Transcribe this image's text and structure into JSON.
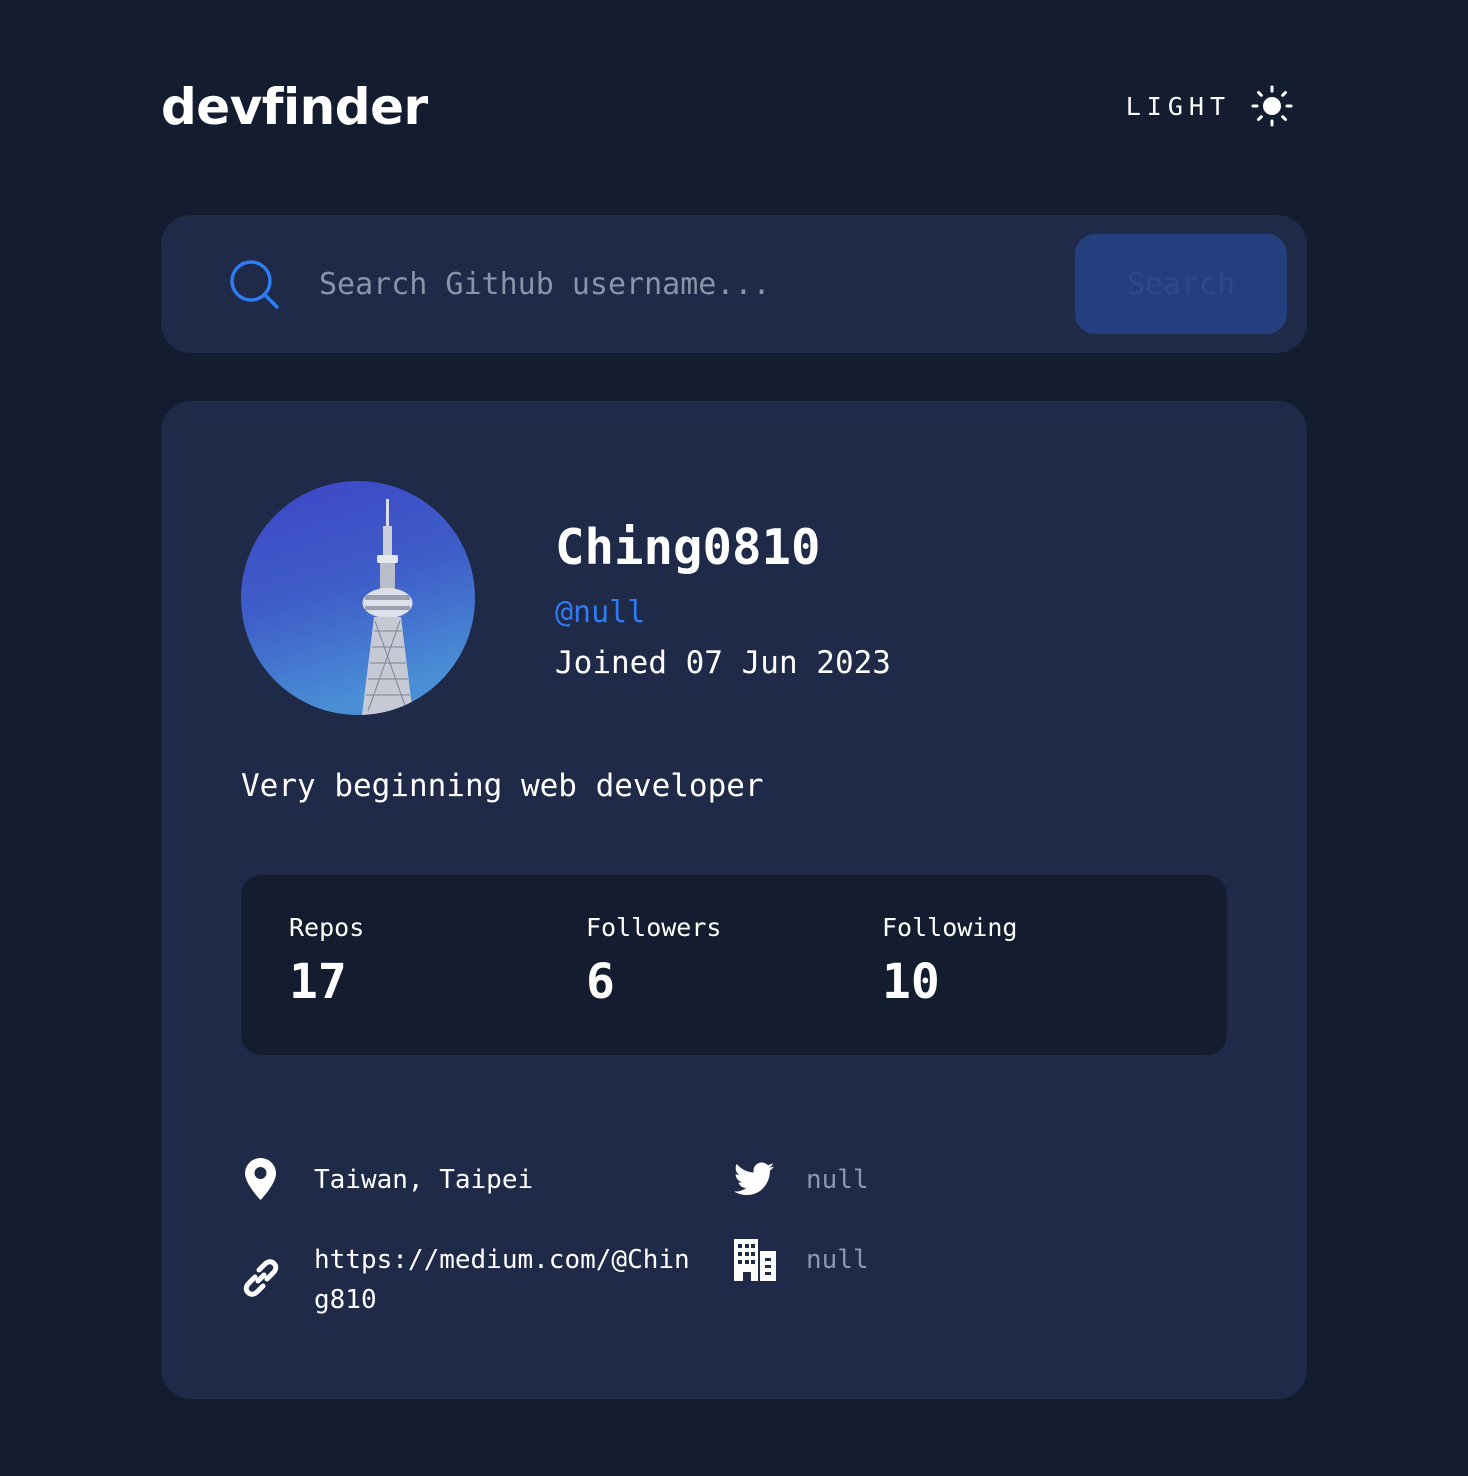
{
  "header": {
    "logo": "devfinder",
    "theme_label": "LIGHT",
    "theme_icon": "sun-icon"
  },
  "search": {
    "icon": "search-icon",
    "placeholder": "Search Github username...",
    "button_label": "Search"
  },
  "profile": {
    "name": "Ching0810",
    "handle": "@null",
    "joined": "Joined 07 Jun 2023",
    "bio": "Very beginning web developer",
    "stats": {
      "repos": {
        "label": "Repos",
        "value": "17"
      },
      "followers": {
        "label": "Followers",
        "value": "6"
      },
      "following": {
        "label": "Following",
        "value": "10"
      }
    },
    "links": {
      "location": {
        "icon": "location-pin-icon",
        "text": "Taiwan, Taipei"
      },
      "twitter": {
        "icon": "twitter-icon",
        "text": "null"
      },
      "website": {
        "icon": "link-icon",
        "text": "https://medium.com/@Ching810"
      },
      "company": {
        "icon": "building-icon",
        "text": "null"
      }
    }
  },
  "colors": {
    "background": "#141d2f",
    "card": "#1e2a47",
    "accent": "#2f7bf2",
    "muted_text": "#8a96b3"
  }
}
